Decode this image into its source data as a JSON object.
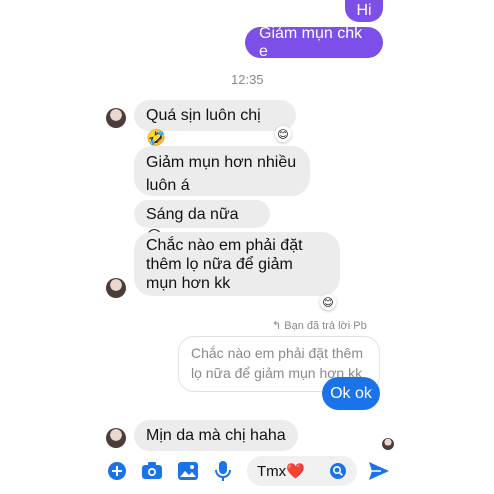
{
  "messages": {
    "out_1": "Hi",
    "out_2": "Giảm mụn chk e",
    "time": "12:35",
    "in_1": "Quá sịn luôn chị 🤣",
    "in_1_react": "😊",
    "in_2": "Giảm mụn hơn nhiều luôn á",
    "in_3": "Sáng da nữa 😆",
    "in_4": "Chắc nào em phải đặt thêm lọ nữa để giảm mụn hơn kk",
    "in_4_react": "😊",
    "reply_note": "↰ Bạn đã trả lời Pb",
    "quoted": "Chắc nào em phải đặt thêm lọ nữa để giảm mụn hơn kk",
    "out_reply": "Ok ok",
    "in_5": "Mịn da mà chị haha"
  },
  "composer": {
    "value": "Tmx❤️",
    "icons": [
      "plus-icon",
      "camera-icon",
      "image-icon",
      "microphone-icon",
      "emoji-icon",
      "send-icon"
    ]
  },
  "colors": {
    "outgoing": "#7b4fe8",
    "reply": "#1a73e8",
    "incoming": "#ececec"
  }
}
